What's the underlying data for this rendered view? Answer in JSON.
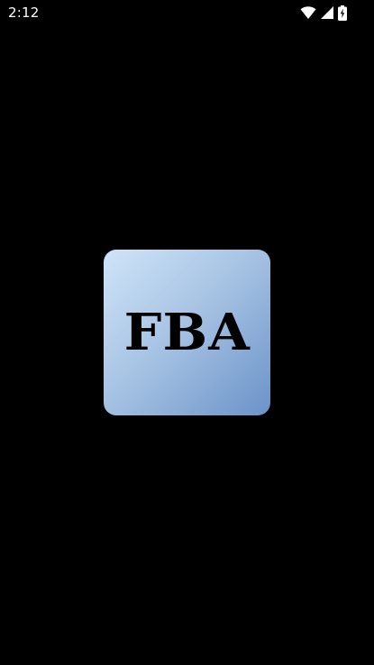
{
  "status_bar": {
    "time": "2:12",
    "icons": [
      "wifi-icon",
      "signal-icon",
      "battery-charging-icon"
    ]
  },
  "splash": {
    "logo_text": "FBA",
    "colors": {
      "background": "#000000",
      "logo_gradient_start": "#cfe4f8",
      "logo_gradient_end": "#6b93c8",
      "logo_text": "#000000"
    }
  }
}
